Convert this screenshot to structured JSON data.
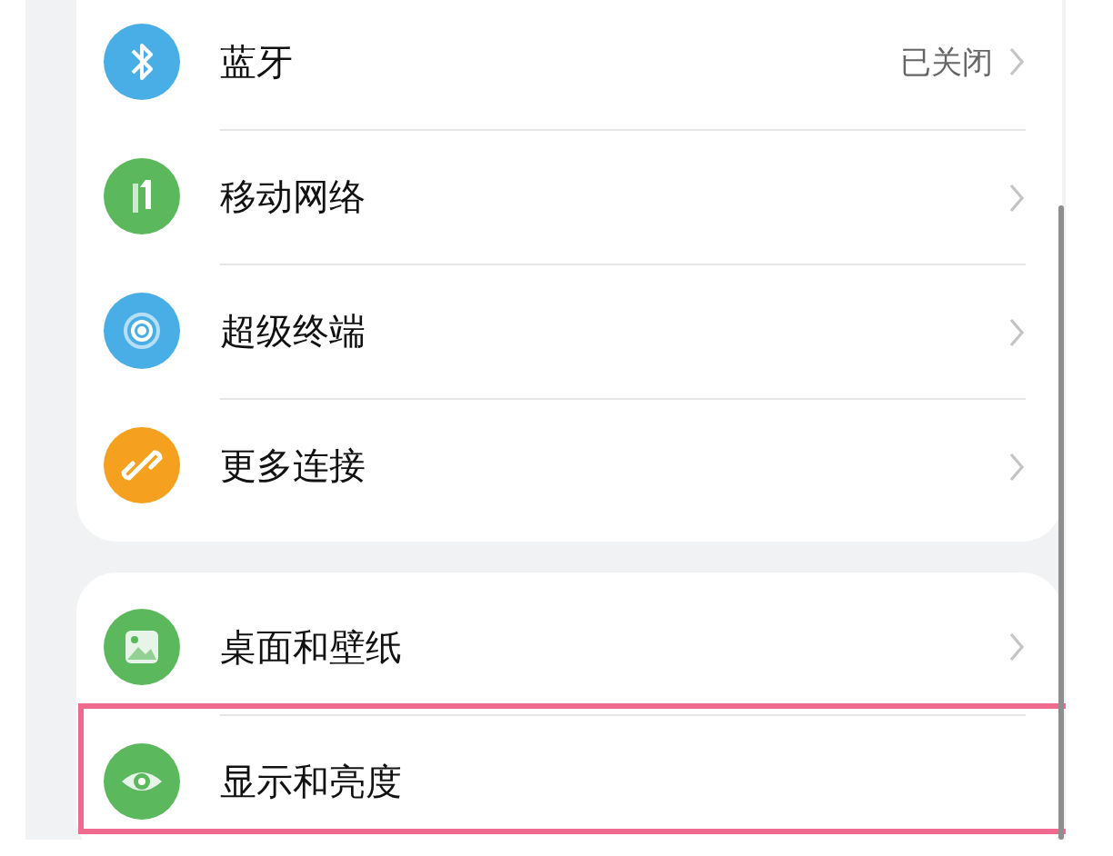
{
  "groups": [
    {
      "items": [
        {
          "label": "蓝牙",
          "value": "已关闭",
          "color": "#4aaee6",
          "highlighted": false
        },
        {
          "label": "移动网络",
          "color": "#5bb85d",
          "highlighted": false
        },
        {
          "label": "超级终端",
          "color": "#4aaee6",
          "highlighted": false
        },
        {
          "label": "更多连接",
          "color": "#f6a020",
          "highlighted": false
        }
      ]
    },
    {
      "items": [
        {
          "label": "桌面和壁纸",
          "color": "#5bb85d",
          "highlighted": false
        },
        {
          "label": "显示和亮度",
          "color": "#5bb85d",
          "highlighted": true
        }
      ]
    }
  ]
}
